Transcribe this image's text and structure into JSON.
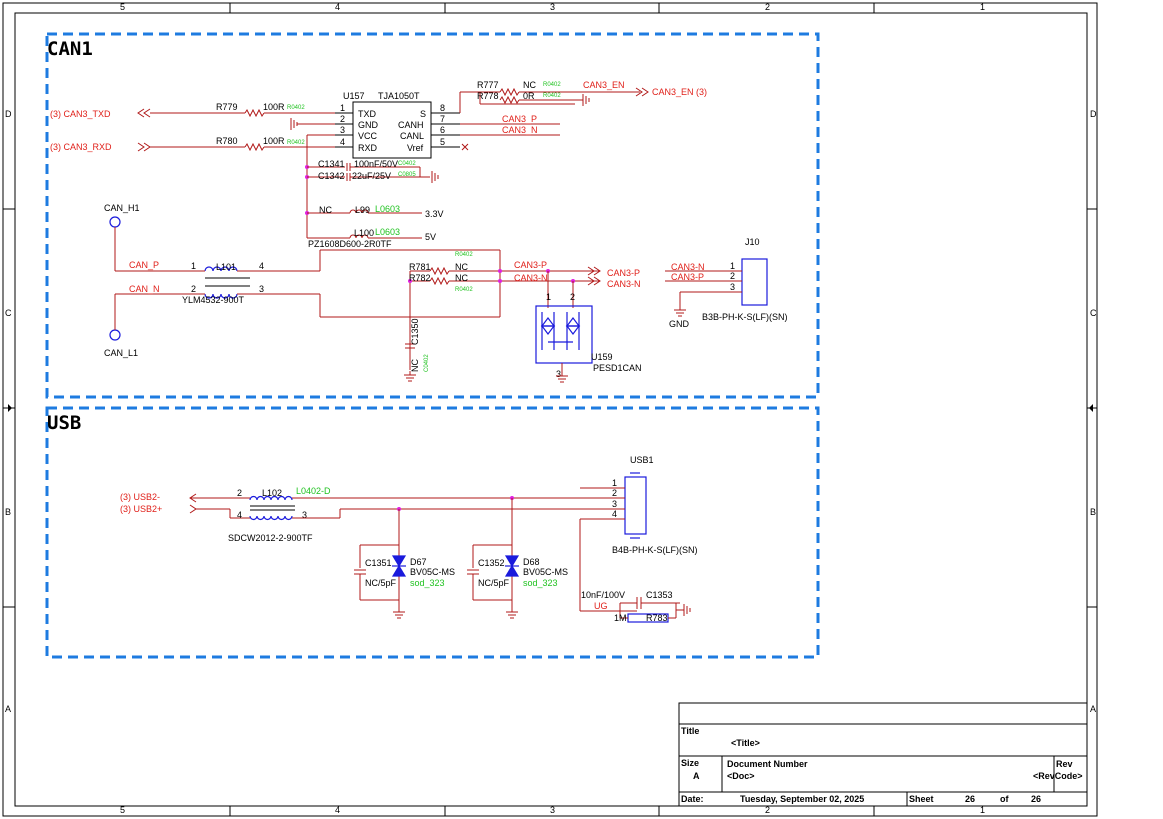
{
  "frame": {
    "columns": [
      "5",
      "4",
      "3",
      "2",
      "1"
    ],
    "rows": [
      "D",
      "C",
      "B",
      "A"
    ]
  },
  "can_section": {
    "title": "CAN1",
    "ports": {
      "txd": "(3) CAN3_TXD",
      "rxd": "(3) CAN3_RXD",
      "en": "CAN3_EN (3)",
      "p_out": "CAN3-P",
      "n_out": "CAN3-N"
    },
    "ic": {
      "ref": "U157",
      "part": "TJA1050T",
      "left_pins": [
        {
          "num": "1",
          "name": "TXD"
        },
        {
          "num": "2",
          "name": "GND"
        },
        {
          "num": "3",
          "name": "VCC"
        },
        {
          "num": "4",
          "name": "RXD"
        }
      ],
      "right_pins": [
        {
          "num": "8",
          "name": "S"
        },
        {
          "num": "7",
          "name": "CANH"
        },
        {
          "num": "6",
          "name": "CANL"
        },
        {
          "num": "5",
          "name": "Vref"
        }
      ]
    },
    "nets": {
      "en": "CAN3_EN",
      "canh": "CAN3_P",
      "canl": "CAN3_N",
      "cp": "CAN_P",
      "cn": "CAN_N",
      "p2": "CAN3-P",
      "n2": "CAN3-N",
      "v33": "3.3V",
      "v5": "5V",
      "gnd": "GND"
    },
    "resistors": [
      {
        "ref": "R779",
        "value": "100R",
        "pkg": "R0402"
      },
      {
        "ref": "R780",
        "value": "100R",
        "pkg": "R0402"
      },
      {
        "ref": "R777",
        "value": "NC",
        "pkg": "R0402"
      },
      {
        "ref": "R778",
        "value": "0R",
        "pkg": "R0402"
      },
      {
        "ref": "R781",
        "value": "NC",
        "pkg": "R0402"
      },
      {
        "ref": "R782",
        "value": "NC",
        "pkg": "R0402"
      }
    ],
    "caps": [
      {
        "ref": "C1341",
        "value": "100nF/50V",
        "pkg": "C0402"
      },
      {
        "ref": "C1342",
        "value": "22uF/25V",
        "pkg": "C0805"
      },
      {
        "ref": "C1350",
        "value": "NC",
        "pkg": "C0402"
      }
    ],
    "inductors": [
      {
        "ref": "L99",
        "value": "NC",
        "pkg": "L0603"
      },
      {
        "ref": "L100",
        "value": "PZ1608D600-2R0TF",
        "pkg": "L0603"
      }
    ],
    "choke": {
      "ref": "L101",
      "part": "YLM4532-900T",
      "pins": [
        "1",
        "2",
        "3",
        "4"
      ]
    },
    "testpoints": [
      "CAN_H1",
      "CAN_L1"
    ],
    "tvs": {
      "ref": "U159",
      "part": "PESD1CAN",
      "pins": [
        "1",
        "2",
        "3"
      ]
    },
    "connector": {
      "ref": "J10",
      "part": "B3B-PH-K-S(LF)(SN)",
      "pins": [
        "1",
        "2",
        "3"
      ]
    }
  },
  "usb_section": {
    "title": "USB",
    "ports": {
      "dm": "(3) USB2-",
      "dp": "(3) USB2+"
    },
    "choke": {
      "ref": "L102",
      "part": "SDCW2012-2-900TF",
      "pkg": "L0402-D",
      "pins": [
        "2",
        "4",
        "3"
      ]
    },
    "diodes": [
      {
        "ref": "D67",
        "part": "BV05C-MS",
        "pkg": "sod_323",
        "cap": "C1351",
        "cap_value": "NC/5pF"
      },
      {
        "ref": "D68",
        "part": "BV05C-MS",
        "pkg": "sod_323",
        "cap": "C1352",
        "cap_value": "NC/5pF"
      }
    ],
    "cap_c1353": {
      "ref": "C1353",
      "value": "10nF/100V"
    },
    "res_r783": {
      "ref": "R783",
      "value": "1M"
    },
    "net_ug": "UG",
    "connector": {
      "ref": "USB1",
      "part": "B4B-PH-K-S(LF)(SN)",
      "pins": [
        "1",
        "2",
        "3",
        "4"
      ]
    }
  },
  "title_block": {
    "title_label": "Title",
    "title_value": "<Title>",
    "size_label": "Size",
    "size_value": "A",
    "doc_label": "Document Number",
    "doc_value": "<Doc>",
    "rev_label": "Rev",
    "rev_value": "<RevCode>",
    "date_label": "Date:",
    "date_value": "Tuesday, September 02, 2025",
    "sheet_label": "Sheet",
    "sheet_num": "26",
    "of_label": "of",
    "sheet_total": "26"
  }
}
